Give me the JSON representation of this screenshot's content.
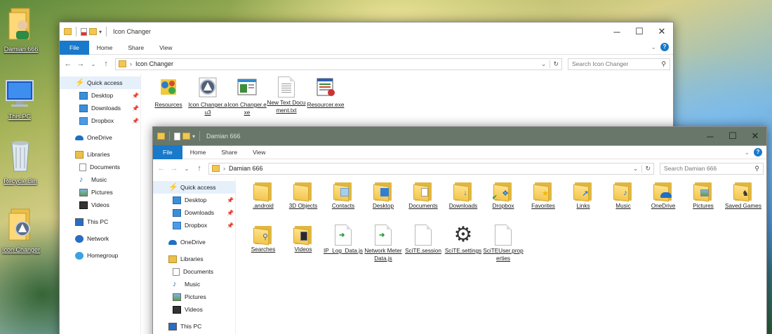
{
  "desktop": {
    "icons": [
      {
        "label": "Damian 666"
      },
      {
        "label": "This PC"
      },
      {
        "label": "Recycle Bin"
      },
      {
        "label": "Icon Changer"
      }
    ]
  },
  "window1": {
    "title": "Icon Changer",
    "ribbon_tabs": [
      "File",
      "Home",
      "Share",
      "View"
    ],
    "address": "Icon Changer",
    "search_placeholder": "Search Icon Changer",
    "nav": [
      {
        "label": "Quick access"
      },
      {
        "label": "Desktop"
      },
      {
        "label": "Downloads"
      },
      {
        "label": "Dropbox"
      },
      {
        "label": "OneDrive"
      },
      {
        "label": "Libraries"
      },
      {
        "label": "Documents"
      },
      {
        "label": "Music"
      },
      {
        "label": "Pictures"
      },
      {
        "label": "Videos"
      },
      {
        "label": "This PC"
      },
      {
        "label": "Network"
      },
      {
        "label": "Homegroup"
      }
    ],
    "files": [
      {
        "label": "Resources"
      },
      {
        "label": "Icon Changer.au3"
      },
      {
        "label": "Icon Changer.exe"
      },
      {
        "label": "New Text Document.txt"
      },
      {
        "label": "Resourcer.exe"
      }
    ]
  },
  "window2": {
    "title": "Damian 666",
    "ribbon_tabs": [
      "File",
      "Home",
      "Share",
      "View"
    ],
    "address": "Damian 666",
    "search_placeholder": "Search Damian 666",
    "nav": [
      {
        "label": "Quick access"
      },
      {
        "label": "Desktop"
      },
      {
        "label": "Downloads"
      },
      {
        "label": "Dropbox"
      },
      {
        "label": "OneDrive"
      },
      {
        "label": "Libraries"
      },
      {
        "label": "Documents"
      },
      {
        "label": "Music"
      },
      {
        "label": "Pictures"
      },
      {
        "label": "Videos"
      },
      {
        "label": "This PC"
      }
    ],
    "files": [
      {
        "label": ".android"
      },
      {
        "label": "3D Objects"
      },
      {
        "label": "Contacts"
      },
      {
        "label": "Desktop"
      },
      {
        "label": "Documents"
      },
      {
        "label": "Downloads"
      },
      {
        "label": "Dropbox"
      },
      {
        "label": "Favorites"
      },
      {
        "label": "Links"
      },
      {
        "label": "Music"
      },
      {
        "label": "OneDrive"
      },
      {
        "label": "Pictures"
      },
      {
        "label": "Saved Games"
      },
      {
        "label": "Searches"
      },
      {
        "label": "Videos"
      },
      {
        "label": "IP_Log_Data.js"
      },
      {
        "label": "Network Meter Data.js"
      },
      {
        "label": "SciTE.session"
      },
      {
        "label": "SciTE.settings"
      },
      {
        "label": "SciTEUser.properties"
      }
    ]
  },
  "colors": {
    "accent": "#1979ca",
    "inactive_titlebar": "#68776a",
    "folder": "#f3c64f"
  }
}
